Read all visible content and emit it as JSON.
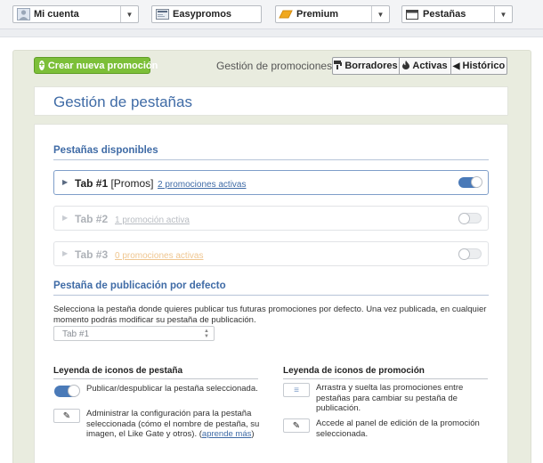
{
  "nav": {
    "account": "Mi cuenta",
    "app": "Easypromos",
    "plan": "Premium",
    "section": "Pestañas"
  },
  "toolbar": {
    "create_label": "Crear nueva promoción",
    "gestion_label": "Gestión de promociones",
    "borradores": "Borradores",
    "activas": "Activas",
    "historico": "Histórico"
  },
  "page": {
    "title": "Gestión de pestañas"
  },
  "tabs_section": {
    "title": "Pestañas disponibles",
    "tabs": [
      {
        "name": "Tab #1",
        "suffix": "[Promos]",
        "promos": "2 promociones activas",
        "published": true
      },
      {
        "name": "Tab #2",
        "suffix": "",
        "promos": "1 promoción activa",
        "published": false
      },
      {
        "name": "Tab #3",
        "suffix": "",
        "promos": "0 promociones activas",
        "published": false
      }
    ]
  },
  "default_section": {
    "title": "Pestaña de publicación por defecto",
    "description": "Selecciona la pestaña donde quieres publicar tus futuras promociones por defecto. Una vez publicada, en cualquier momento podrás modificar su pestaña de publicación.",
    "selected": "Tab #1"
  },
  "legend_tab": {
    "title": "Leyenda de iconos de pestaña",
    "toggle_text": "Publicar/despublicar la pestaña seleccionada.",
    "edit_text": "Administrar la configuración para la pestaña seleccionada (cómo el nombre de pestaña, su imagen, el Like Gate y otros).",
    "learn_more": "aprende más"
  },
  "legend_promo": {
    "title": "Leyenda de iconos de promoción",
    "drag_text": "Arrastra y suelta las promociones entre pestañas para cambiar su pestaña de publicación.",
    "edit_text": "Accede al panel de edición de la promoción seleccionada."
  },
  "colors": {
    "accent_blue": "#3f6ba6",
    "create_green": "#7cbf38"
  }
}
